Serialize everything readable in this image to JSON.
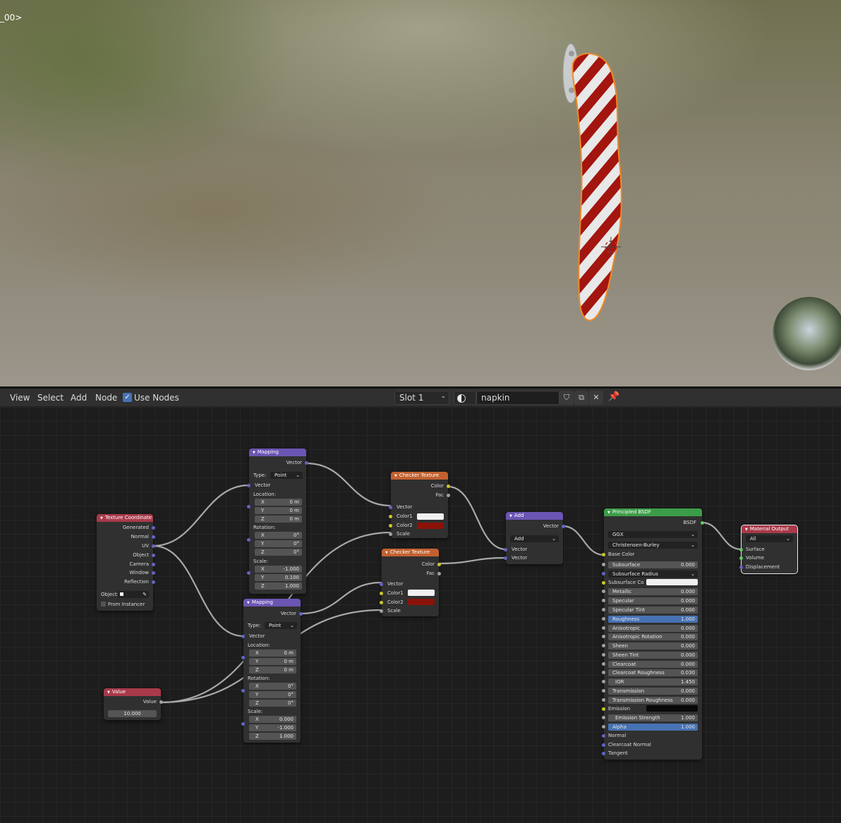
{
  "viewport": {
    "label": "_00>"
  },
  "header": {
    "menus": [
      "View",
      "Select",
      "Add",
      "Node"
    ],
    "use_nodes_label": "Use Nodes",
    "use_nodes_checked": true,
    "slot": "Slot 1",
    "material_name": "napkin"
  },
  "nodes": {
    "mapping1": {
      "title": "Mapping",
      "out": "Vector",
      "type_label": "Type:",
      "type_value": "Point",
      "in": "Vector",
      "location_label": "Location:",
      "loc": [
        "0 m",
        "0 m",
        "0 m"
      ],
      "rotation_label": "Rotation:",
      "rot": [
        "0°",
        "0°",
        "0°"
      ],
      "scale_label": "Scale:",
      "scale": [
        "-1.000",
        "0.100",
        "1.000"
      ]
    },
    "mapping2": {
      "title": "Mapping",
      "out": "Vector",
      "type_label": "Type:",
      "type_value": "Point",
      "in": "Vector",
      "location_label": "Location:",
      "loc": [
        "0 m",
        "0 m",
        "0 m"
      ],
      "rotation_label": "Rotation:",
      "rot": [
        "0°",
        "0°",
        "0°"
      ],
      "scale_label": "Scale:",
      "scale": [
        "0.000",
        "-1.000",
        "1.000"
      ]
    },
    "axes": [
      "X",
      "Y",
      "Z"
    ],
    "texcoord": {
      "title": "Texture Coordinate",
      "outputs": [
        "Generated",
        "Normal",
        "UV",
        "Object",
        "Camera",
        "Window",
        "Reflection"
      ],
      "object_label": "Object:",
      "from_instancer": "From Instancer"
    },
    "value": {
      "title": "Value",
      "out": "Value",
      "value": "10.000"
    },
    "checker1": {
      "title": "Checker Texture",
      "outputs": [
        "Color",
        "Fac"
      ],
      "inputs": [
        "Vector",
        "Color1",
        "Color2",
        "Scale"
      ],
      "color1": "#f0f0f0",
      "color2": "#8a1208"
    },
    "checker2": {
      "title": "Checker Texture",
      "outputs": [
        "Color",
        "Fac"
      ],
      "inputs": [
        "Vector",
        "Color1",
        "Color2",
        "Scale"
      ],
      "color1": "#f0f0f0",
      "color2": "#8a1208"
    },
    "add": {
      "title": "Add",
      "out": "Vector",
      "op": "Add",
      "inputs": [
        "Vector",
        "Vector"
      ]
    },
    "bsdf": {
      "title": "Principled BSDF",
      "out": "BSDF",
      "distribution": "GGX",
      "subsurface_method": "Christensen-Burley",
      "base_color": "Base Color",
      "fields": [
        {
          "k": "Subsurface",
          "v": "0.000"
        },
        {
          "k": "Subsurface Radius",
          "v": ""
        },
        {
          "k": "Subsurface Co",
          "v": ""
        },
        {
          "k": "Metallic",
          "v": "0.000"
        },
        {
          "k": "Specular",
          "v": "0.000"
        },
        {
          "k": "Specular Tint",
          "v": "0.000"
        },
        {
          "k": "Roughness",
          "v": "1.000"
        },
        {
          "k": "Anisotropic",
          "v": "0.000"
        },
        {
          "k": "Anisotropic Rotation",
          "v": "0.000"
        },
        {
          "k": "Sheen",
          "v": "0.000"
        },
        {
          "k": "Sheen Tint",
          "v": "0.000"
        },
        {
          "k": "Clearcoat",
          "v": "0.000"
        },
        {
          "k": "Clearcoat Roughness",
          "v": "0.030"
        },
        {
          "k": "IOR",
          "v": "1.450"
        },
        {
          "k": "Transmission",
          "v": "0.000"
        },
        {
          "k": "Transmission Roughness",
          "v": "0.000"
        },
        {
          "k": "Emission",
          "v": ""
        },
        {
          "k": "Emission Strength",
          "v": "1.000"
        },
        {
          "k": "Alpha",
          "v": "1.000"
        }
      ],
      "vector_inputs": [
        "Normal",
        "Clearcoat Normal",
        "Tangent"
      ]
    },
    "output": {
      "title": "Material Output",
      "target": "All",
      "inputs": [
        "Surface",
        "Volume",
        "Displacement"
      ]
    }
  },
  "colors": {
    "shader_socket": "#63c763",
    "color_socket": "#c7c729",
    "vector_socket": "#6363c7",
    "float_socket": "#a1a1a1",
    "accent_blue": "#4772b3"
  }
}
